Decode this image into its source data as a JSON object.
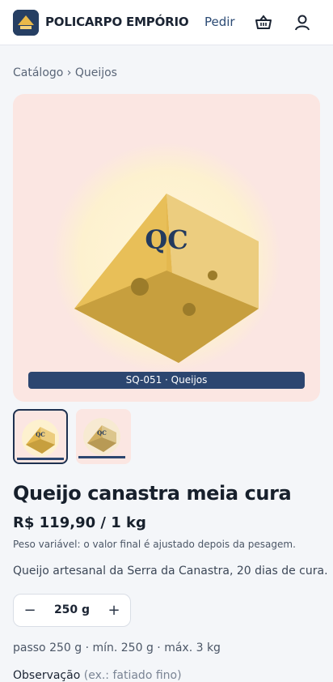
{
  "header": {
    "brand": "POLICARPO EMPÓRIO",
    "nav_link": "Pedir",
    "logo_icon": "store-logo-icon",
    "basket_icon": "basket-icon",
    "user_icon": "user-icon"
  },
  "breadcrumb": "Catálogo › Queijos",
  "product": {
    "image_monogram": "QC",
    "image_tag": "SQ-051 · Queijos",
    "title": "Queijo canastra meia cura",
    "price": "R$ 119,90 / 1 kg",
    "weight_note": "Peso variável: o valor final é ajustado depois da pesagem.",
    "description": "Queijo artesanal da Serra da Canastra, 20 dias de cura.",
    "quantity": "250 g",
    "decrement_label": "−",
    "increment_label": "+",
    "rules": "passo 250 g · mín. 250 g · máx. 3 kg",
    "observation_label": "Observação",
    "observation_hint": "(ex.: fatiado fino)"
  },
  "colors": {
    "accent": "#2c4670",
    "hero_bg": "#fbe6e2",
    "cheese": "#e4b84f"
  }
}
